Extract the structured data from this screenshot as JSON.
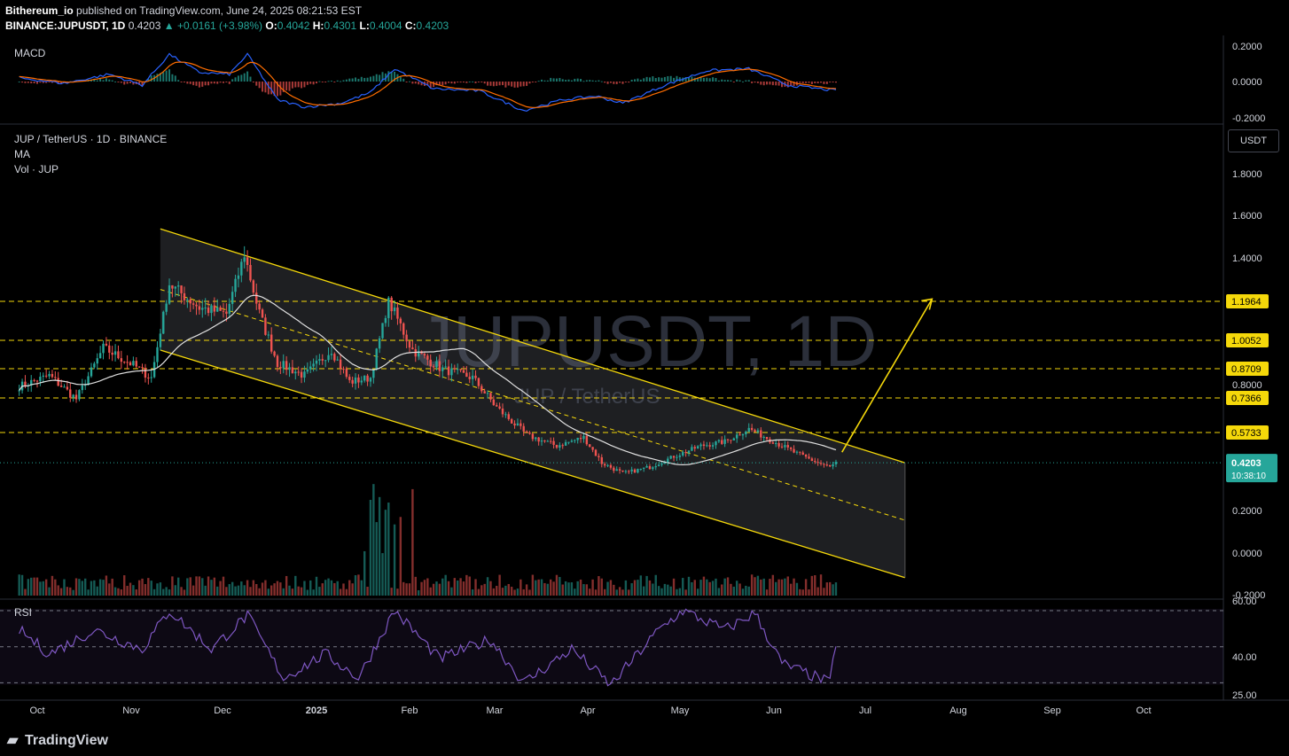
{
  "header": {
    "publisher": "Bithereum_io",
    "published_text": " published on TradingView.com, June 24, 2025 08:21:53 EST",
    "symbol": "BINANCE:JUPUSDT, 1D",
    "last": "0.4203",
    "change": "▲ +0.0161 (+3.98%)",
    "o_label": "O:",
    "o": "0.4042",
    "h_label": "H:",
    "h": "0.4301",
    "l_label": "L:",
    "l": "0.4004",
    "c_label": "C:",
    "c": "0.4203"
  },
  "labels": {
    "macd": "MACD",
    "pair": "JUP / TetherUS · 1D · BINANCE",
    "ma": "MA",
    "vol": "Vol · JUP",
    "rsi": "RSI",
    "watermark_big": "JUPUSDT, 1D",
    "watermark_small": "JUP / TetherUS",
    "currency_button": "USDT",
    "brand": "TradingView"
  },
  "colors": {
    "up": "#26a69a",
    "down": "#ef5350",
    "channel": "#f5d80a",
    "level": "#f5d80a",
    "ma": "#e0e0e0",
    "macd": "#2962ff",
    "signal": "#ff6d00",
    "rsi": "#7e57c2",
    "price_tag": "#26a69a"
  },
  "chart_data": [
    {
      "type": "candlestick",
      "title": "JUP / TetherUS · 1D · BINANCE",
      "x_axis_ticks": [
        "Oct",
        "Nov",
        "Dec",
        "2025",
        "Feb",
        "Mar",
        "Apr",
        "May",
        "Jun",
        "Jul",
        "Aug",
        "Sep",
        "Oct"
      ],
      "y_axis_ticks": [
        "1.8000",
        "1.6000",
        "1.4000",
        "0.8000",
        "0.2000",
        "0.0000",
        "-0.2000"
      ],
      "ylim": [
        -0.2,
        1.9
      ],
      "price_points": [
        {
          "date": "2024-09-25",
          "close": 0.78
        },
        {
          "date": "2024-10-05",
          "close": 0.83
        },
        {
          "date": "2024-10-14",
          "close": 0.72
        },
        {
          "date": "2024-10-23",
          "close": 0.96
        },
        {
          "date": "2024-11-02",
          "close": 0.88
        },
        {
          "date": "2024-11-08",
          "close": 0.82
        },
        {
          "date": "2024-11-14",
          "close": 1.26
        },
        {
          "date": "2024-11-24",
          "close": 1.15
        },
        {
          "date": "2024-12-03",
          "close": 1.12
        },
        {
          "date": "2024-12-09",
          "close": 1.4
        },
        {
          "date": "2024-12-14",
          "close": 1.12
        },
        {
          "date": "2024-12-20",
          "close": 0.89
        },
        {
          "date": "2024-12-29",
          "close": 0.83
        },
        {
          "date": "2025-01-07",
          "close": 0.95
        },
        {
          "date": "2025-01-13",
          "close": 0.8
        },
        {
          "date": "2025-01-20",
          "close": 0.82
        },
        {
          "date": "2025-01-26",
          "close": 1.18
        },
        {
          "date": "2025-02-03",
          "close": 0.95
        },
        {
          "date": "2025-02-13",
          "close": 0.86
        },
        {
          "date": "2025-02-23",
          "close": 0.82
        },
        {
          "date": "2025-03-03",
          "close": 0.68
        },
        {
          "date": "2025-03-13",
          "close": 0.55
        },
        {
          "date": "2025-03-23",
          "close": 0.5
        },
        {
          "date": "2025-04-01",
          "close": 0.54
        },
        {
          "date": "2025-04-07",
          "close": 0.42
        },
        {
          "date": "2025-04-14",
          "close": 0.37
        },
        {
          "date": "2025-04-23",
          "close": 0.4
        },
        {
          "date": "2025-05-01",
          "close": 0.45
        },
        {
          "date": "2025-05-10",
          "close": 0.5
        },
        {
          "date": "2025-05-18",
          "close": 0.52
        },
        {
          "date": "2025-05-26",
          "close": 0.58
        },
        {
          "date": "2025-06-02",
          "close": 0.53
        },
        {
          "date": "2025-06-10",
          "close": 0.47
        },
        {
          "date": "2025-06-18",
          "close": 0.42
        },
        {
          "date": "2025-06-22",
          "close": 0.4
        },
        {
          "date": "2025-06-24",
          "close": 0.4203
        }
      ],
      "horizontal_levels": [
        "1.1964",
        "1.0052",
        "0.8709",
        "0.7366",
        "0.5733"
      ],
      "current_price": "0.4203",
      "countdown": "10:38:10",
      "channel": {
        "upper": [
          {
            "date": "2024-11-11",
            "price": 1.52
          },
          {
            "date": "2025-07-17",
            "price": 0.42
          }
        ],
        "lower": [
          {
            "date": "2024-11-11",
            "price": 0.95
          },
          {
            "date": "2025-07-17",
            "price": -0.12
          }
        ]
      },
      "projection_arrow": {
        "from": {
          "date": "2025-06-26",
          "price": 0.47
        },
        "to": {
          "date": "2025-07-26",
          "price": 1.19
        }
      }
    },
    {
      "type": "line",
      "title": "MACD",
      "y_axis_ticks": [
        "0.2000",
        "0.0000",
        "-0.2000"
      ],
      "ylim": [
        -0.22,
        0.22
      ],
      "series": [
        {
          "name": "MACD",
          "points": [
            {
              "date": "2024-09-25",
              "value": 0.02
            },
            {
              "date": "2024-10-10",
              "value": -0.01
            },
            {
              "date": "2024-10-25",
              "value": 0.04
            },
            {
              "date": "2024-11-05",
              "value": -0.02
            },
            {
              "date": "2024-11-14",
              "value": 0.15
            },
            {
              "date": "2024-11-24",
              "value": 0.05
            },
            {
              "date": "2024-12-04",
              "value": 0.04
            },
            {
              "date": "2024-12-10",
              "value": 0.15
            },
            {
              "date": "2024-12-20",
              "value": -0.1
            },
            {
              "date": "2024-12-29",
              "value": -0.14
            },
            {
              "date": "2025-01-10",
              "value": -0.12
            },
            {
              "date": "2025-01-20",
              "value": -0.06
            },
            {
              "date": "2025-01-28",
              "value": 0.07
            },
            {
              "date": "2025-02-10",
              "value": -0.04
            },
            {
              "date": "2025-02-25",
              "value": -0.05
            },
            {
              "date": "2025-03-12",
              "value": -0.16
            },
            {
              "date": "2025-03-25",
              "value": -0.1
            },
            {
              "date": "2025-04-05",
              "value": -0.08
            },
            {
              "date": "2025-04-14",
              "value": -0.12
            },
            {
              "date": "2025-04-28",
              "value": -0.02
            },
            {
              "date": "2025-05-12",
              "value": 0.06
            },
            {
              "date": "2025-05-26",
              "value": 0.07
            },
            {
              "date": "2025-06-08",
              "value": -0.02
            },
            {
              "date": "2025-06-24",
              "value": -0.05
            }
          ]
        }
      ]
    },
    {
      "type": "line",
      "title": "RSI",
      "y_axis_ticks": [
        "60.00",
        "40.00",
        "25.00"
      ],
      "ylim": [
        25,
        62
      ],
      "series": [
        {
          "name": "RSI",
          "points": [
            {
              "date": "2024-09-25",
              "value": 52
            },
            {
              "date": "2024-10-05",
              "value": 42
            },
            {
              "date": "2024-10-20",
              "value": 52
            },
            {
              "date": "2024-11-05",
              "value": 44
            },
            {
              "date": "2024-11-14",
              "value": 60
            },
            {
              "date": "2024-11-28",
              "value": 44
            },
            {
              "date": "2024-12-10",
              "value": 58
            },
            {
              "date": "2024-12-22",
              "value": 32
            },
            {
              "date": "2025-01-05",
              "value": 42
            },
            {
              "date": "2025-01-16",
              "value": 32
            },
            {
              "date": "2025-01-28",
              "value": 60
            },
            {
              "date": "2025-02-12",
              "value": 40
            },
            {
              "date": "2025-03-01",
              "value": 48
            },
            {
              "date": "2025-03-12",
              "value": 30
            },
            {
              "date": "2025-03-28",
              "value": 44
            },
            {
              "date": "2025-04-10",
              "value": 29
            },
            {
              "date": "2025-04-26",
              "value": 52
            },
            {
              "date": "2025-05-04",
              "value": 60
            },
            {
              "date": "2025-05-18",
              "value": 52
            },
            {
              "date": "2025-05-28",
              "value": 59
            },
            {
              "date": "2025-06-06",
              "value": 38
            },
            {
              "date": "2025-06-22",
              "value": 30
            },
            {
              "date": "2025-06-24",
              "value": 47
            }
          ]
        }
      ]
    }
  ]
}
